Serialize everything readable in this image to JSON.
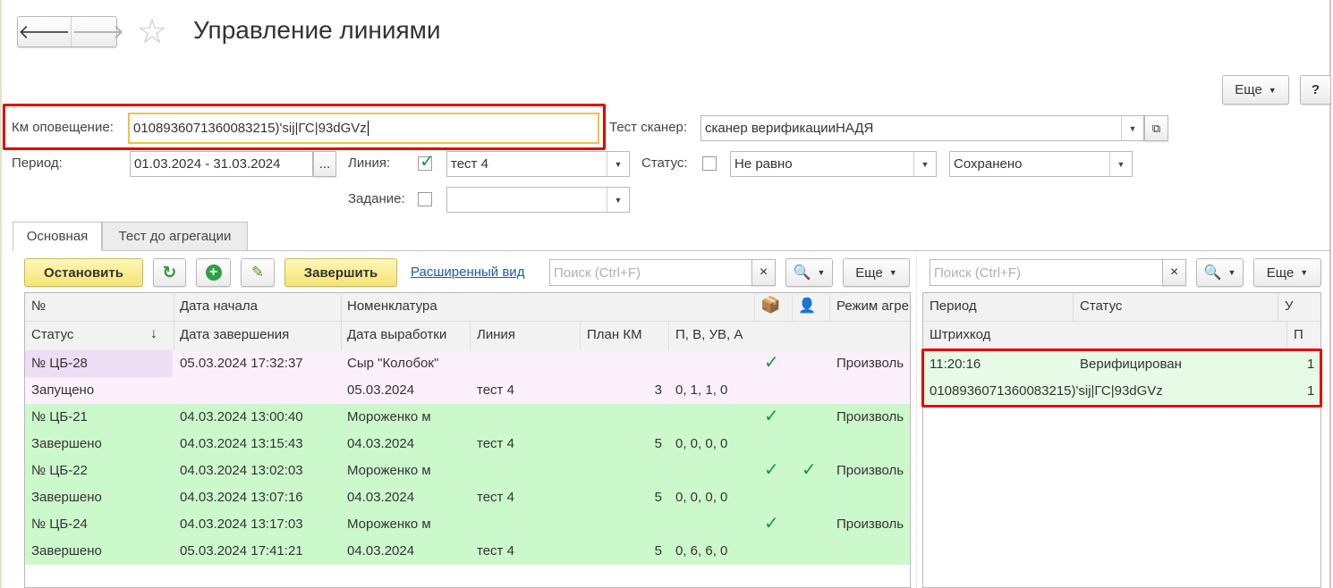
{
  "window": {
    "title": "Управление линиями"
  },
  "nav": {
    "back_icon": "arrow-left-icon",
    "forward_icon": "arrow-right-icon",
    "favorite_icon": "star-icon"
  },
  "toolbar_top": {
    "more_label": "Еще",
    "help_label": "?"
  },
  "filters": {
    "km_label": "Км оповещение:",
    "km_value": "0108936071360083215)'sij|ГС|93dGVz",
    "scanner_label": "Тест сканер:",
    "scanner_value": "сканер верификацииНАДЯ",
    "period_label": "Период:",
    "period_value": "01.03.2024 - 31.03.2024",
    "period_button": "...",
    "line_label": "Линия:",
    "line_checked": true,
    "line_value": "тест 4",
    "status_label": "Статус:",
    "status_checked": false,
    "status_cond_value": "Не равно",
    "status_value": "Сохранено",
    "task_label": "Задание:",
    "task_checked": false,
    "task_value": ""
  },
  "tabs": [
    {
      "label": "Основная",
      "active": true
    },
    {
      "label": "Тест до агрегации",
      "active": false
    }
  ],
  "left_toolbar": {
    "stop_label": "Остановить",
    "finish_label": "Завершить",
    "extended_view_link": "Расширенный вид",
    "search_placeholder": "Поиск (Ctrl+F)",
    "more_label": "Еще"
  },
  "left_table": {
    "header_row1": [
      "№",
      "Дата начала",
      "Номенклатура",
      "",
      "",
      "Режим агре"
    ],
    "header_row2": [
      "Статус",
      "Дата завершения",
      "Дата выработки",
      "Линия",
      "План КМ",
      "П, В, УВ, А"
    ],
    "sort_icon": "sort-down-icon",
    "box_icon": "box-icon",
    "person_icon": "person-icon",
    "rows": [
      {
        "num": "№ ЦБ-28",
        "start": "05.03.2024 17:32:37",
        "nom": "Сыр \"Колобок\"",
        "check1": true,
        "check2": false,
        "mode": "Произволь",
        "status": "Запущено",
        "end": "",
        "prod_date": "05.03.2024",
        "line": "тест 4",
        "plan": "3",
        "pvua": "0, 1, 1, 0",
        "color": "#fcf0fc",
        "num_color": "#efdcf5"
      },
      {
        "num": "№ ЦБ-21",
        "start": "04.03.2024 13:00:40",
        "nom": "Мороженко м",
        "check1": true,
        "check2": false,
        "mode": "Произволь",
        "status": "Завершено",
        "end": "04.03.2024 13:15:43",
        "prod_date": "04.03.2024",
        "line": "тест 4",
        "plan": "5",
        "pvua": "0, 0, 0, 0",
        "color": "#ccf9cc",
        "num_color": "#ccf9cc"
      },
      {
        "num": "№ ЦБ-22",
        "start": "04.03.2024 13:02:03",
        "nom": "Мороженко м",
        "check1": true,
        "check2": true,
        "mode": "Произволь",
        "status": "Завершено",
        "end": "04.03.2024 13:07:16",
        "prod_date": "04.03.2024",
        "line": "тест 4",
        "plan": "5",
        "pvua": "0, 0, 0, 0",
        "color": "#ccf9cc",
        "num_color": "#ccf9cc"
      },
      {
        "num": "№ ЦБ-24",
        "start": "04.03.2024 13:17:03",
        "nom": "Мороженко м",
        "check1": true,
        "check2": false,
        "mode": "Произволь",
        "status": "Завершено",
        "end": "05.03.2024 17:41:21",
        "prod_date": "04.03.2024",
        "line": "тест 4",
        "plan": "5",
        "pvua": "0, 6, 6, 0",
        "color": "#ccf9cc",
        "num_color": "#ccf9cc"
      }
    ]
  },
  "right_toolbar": {
    "search_placeholder": "Поиск (Ctrl+F)",
    "more_label": "Еще"
  },
  "right_table": {
    "header_row1": [
      "Период",
      "Статус",
      "У"
    ],
    "header_row2": [
      "Штрихкод",
      "П"
    ],
    "row": {
      "time": "11:20:16",
      "status": "Верифицирован",
      "u": "1",
      "barcode": "0108936071360083215)'sij|ГС|93dGVz",
      "p": "1",
      "color": "#e6fae6"
    }
  },
  "colors": {
    "accent_red": "#e30000",
    "green_row": "#ccf9cc",
    "pink_row": "#fcf0fc",
    "check_green": "#1a9a3a",
    "link": "#1f5aa8"
  }
}
